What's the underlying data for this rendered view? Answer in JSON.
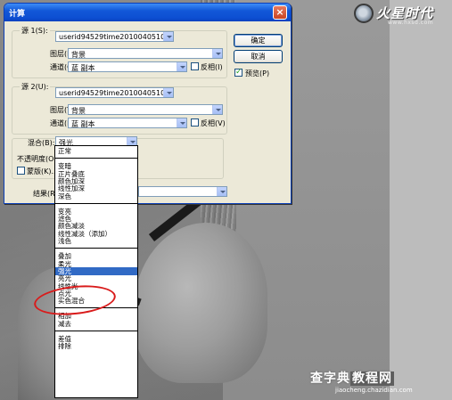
{
  "dialog": {
    "title": "计算",
    "close": "×",
    "source1": {
      "label": "源 1(S):",
      "file": "userid94529time2010040510...",
      "layer_label": "图层(L):",
      "layer": "背景",
      "channel_label": "通道(C):",
      "channel": "蓝 副本",
      "invert_label": "反相(I)"
    },
    "source2": {
      "label": "源 2(U):",
      "file": "userid94529time2010040510...",
      "layer_label": "图层(Y):",
      "layer": "背景",
      "channel_label": "通道(H):",
      "channel": "蓝 副本",
      "invert_label": "反相(V)"
    },
    "blend": {
      "label": "混合(B):",
      "value": "强光",
      "opacity_label": "不透明度(O",
      "mask_label": "蒙版(K)..."
    },
    "result_label": "结果(R",
    "ok": "确定",
    "cancel": "取消",
    "preview_label": "预览(P)",
    "preview_checked": true
  },
  "blend_modes": {
    "groups": [
      [
        "正常"
      ],
      [
        "变暗",
        "正片叠底",
        "颜色加深",
        "线性加深",
        "深色"
      ],
      [
        "变亮",
        "滤色",
        "颜色减淡",
        "线性减淡（添加）",
        "浅色"
      ],
      [
        "叠加",
        "柔光",
        "强光",
        "亮光",
        "线性光",
        "点光",
        "实色混合"
      ],
      [
        "相加",
        "减去"
      ],
      [
        "差值",
        "排除"
      ]
    ],
    "selected": "强光"
  },
  "logo": {
    "title": "火星时代",
    "url": "www.hxsd.com"
  },
  "watermark": {
    "main_a": "查字典",
    "main_b": "教程网",
    "url": "jiaocheng.chazidian.com"
  },
  "colors": {
    "titlebar": "#0d4fd2",
    "selection": "#316ac5",
    "annotation": "#d91b1b"
  }
}
